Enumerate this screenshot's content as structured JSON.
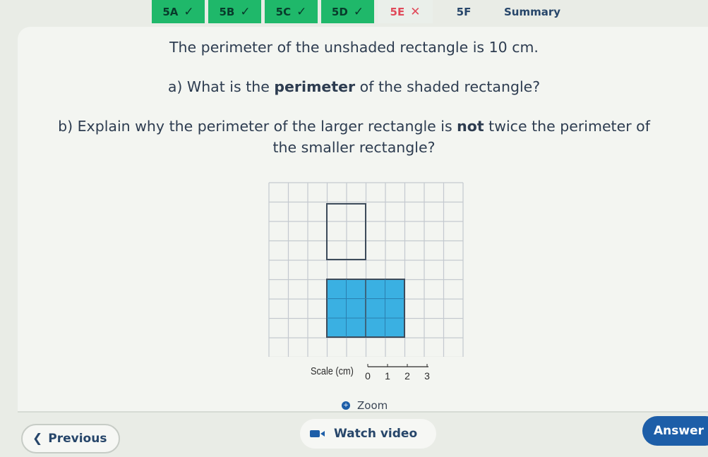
{
  "tabs": [
    {
      "label": "5A",
      "status": "done",
      "mark": "✓"
    },
    {
      "label": "5B",
      "status": "done",
      "mark": "✓"
    },
    {
      "label": "5C",
      "status": "done",
      "mark": "✓"
    },
    {
      "label": "5D",
      "status": "done",
      "mark": "✓"
    },
    {
      "label": "5E",
      "status": "wrong",
      "mark": "✕"
    },
    {
      "label": "5F",
      "status": "current",
      "mark": ""
    },
    {
      "label": "Summary",
      "status": "plain",
      "mark": ""
    }
  ],
  "question": {
    "intro": "The perimeter of the unshaded rectangle is 10 cm.",
    "part_a_prefix": "a) What is the ",
    "part_a_bold": "perimeter",
    "part_a_suffix": " of the shaded rectangle?",
    "part_b_line1_prefix": "b) Explain why the perimeter of the larger rectangle is ",
    "part_b_bold": "not",
    "part_b_line1_suffix": " twice the perimeter of",
    "part_b_line2": "the smaller rectangle?"
  },
  "diagram": {
    "shaded_color": "#3ab0e2",
    "scale_label": "Scale (cm)",
    "scale_ticks": [
      "0",
      "1",
      "2",
      "3"
    ]
  },
  "zoom_label": "Zoom",
  "buttons": {
    "previous": "Previous",
    "watch_video": "Watch video",
    "answer": "Answer"
  },
  "colors": {
    "accent": "#1d5ea8",
    "done": "#1fb86a",
    "wrong": "#e04a5a"
  }
}
